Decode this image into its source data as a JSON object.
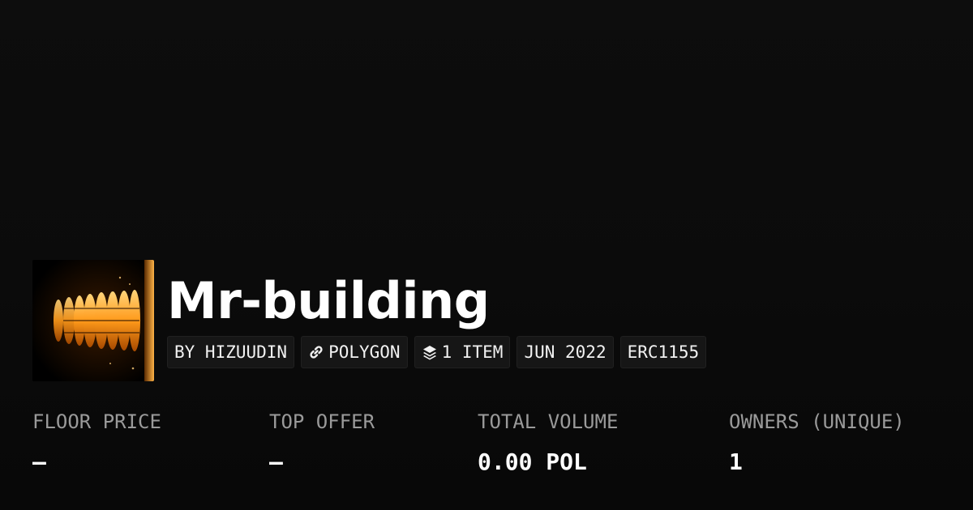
{
  "collection": {
    "title": "Mr-building",
    "thumbnail_icon": "illuminated-tower-image"
  },
  "tags": {
    "creator": "BY HIZUUDIN",
    "chain": "POLYGON",
    "chain_icon": "link-icon",
    "items": "1 ITEM",
    "items_icon": "layers-icon",
    "date": "JUN 2022",
    "standard": "ERC1155"
  },
  "stats": {
    "floor_price": {
      "label": "FLOOR PRICE",
      "value": "–"
    },
    "top_offer": {
      "label": "TOP OFFER",
      "value": "–"
    },
    "total_volume": {
      "label": "TOTAL VOLUME",
      "value": "0.00 POL"
    },
    "owners": {
      "label": "OWNERS (UNIQUE)",
      "value": "1"
    }
  },
  "colors": {
    "background": "#0b0b0b",
    "text": "#ffffff",
    "label": "#9a9a9a",
    "tag_background": "#161616",
    "thumbnail_glow": "#ffa31a"
  }
}
